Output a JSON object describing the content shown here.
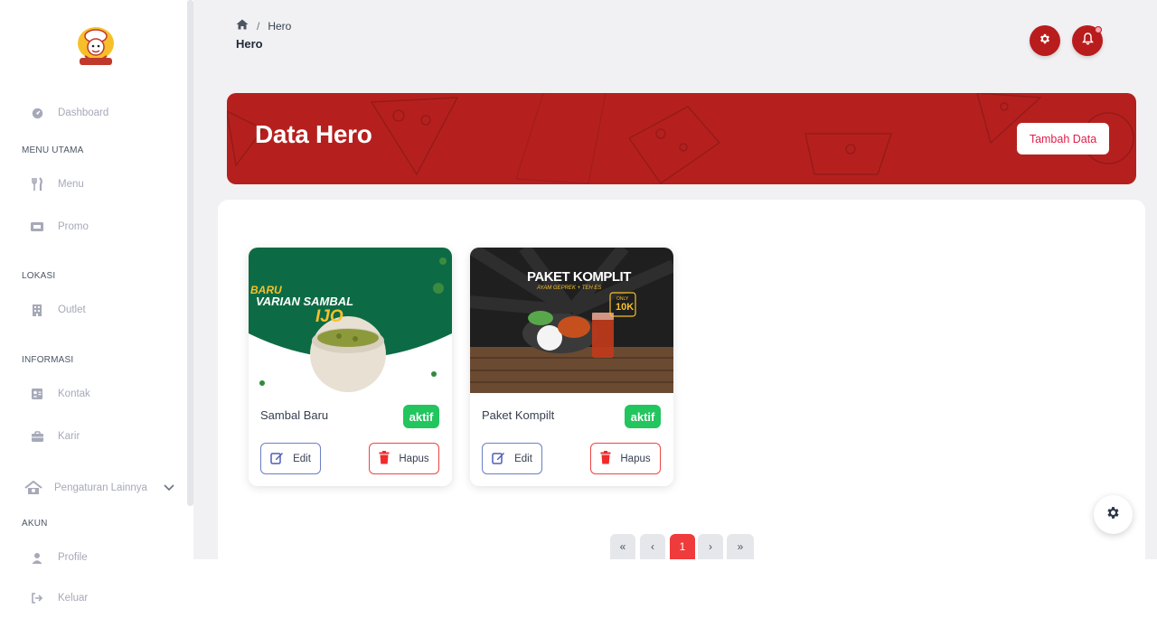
{
  "sidebar": {
    "logo_icon": "chef-mascot-logo",
    "items": [
      {
        "label": "Dashboard",
        "icon": "dashboard-icon"
      },
      {
        "label": "Menu",
        "icon": "fork-knife-icon"
      },
      {
        "label": "Promo",
        "icon": "ticket-icon"
      },
      {
        "label": "Outlet",
        "icon": "building-icon"
      },
      {
        "label": "Kontak",
        "icon": "contact-card-icon"
      },
      {
        "label": "Karir",
        "icon": "briefcase-icon"
      },
      {
        "label": "Pengaturan Lainnya",
        "icon": "settings-house-icon"
      },
      {
        "label": "Profile",
        "icon": "user-icon"
      },
      {
        "label": "Keluar",
        "icon": "logout-icon"
      }
    ],
    "sections": {
      "menu_utama": "MENU UTAMA",
      "lokasi": "LOKASI",
      "informasi": "INFORMASI",
      "akun": "AKUN"
    }
  },
  "header": {
    "breadcrumb_current": "Hero",
    "breadcrumb_sep": "/",
    "page_title": "Hero"
  },
  "hero": {
    "title": "Data Hero",
    "add_button": "Tambah Data"
  },
  "cards": [
    {
      "name": "Sambal Baru",
      "status": "aktif",
      "edit_label": "Edit",
      "delete_label": "Hapus",
      "image_text": {
        "line1": "BARU",
        "line2": "VARIAN SAMBAL",
        "line3": "IJO"
      }
    },
    {
      "name": "Paket Kompilt",
      "status": "aktif",
      "edit_label": "Edit",
      "delete_label": "Hapus",
      "image_text": {
        "line1": "PAKET KOMPLIT",
        "line2": "AYAM GEPREK + TEH ES",
        "price_top": "ONLY",
        "price": "10K"
      }
    }
  ],
  "pagination": {
    "first": "«",
    "prev": "‹",
    "current": "1",
    "next": "›",
    "last": "»"
  },
  "colors": {
    "brand_red": "#b5201e",
    "active_green": "#22c55e",
    "danger": "#ef4444"
  }
}
